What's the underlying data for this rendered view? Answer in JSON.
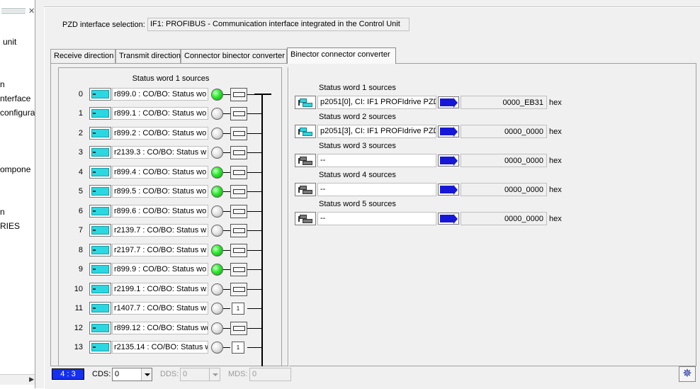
{
  "tree": {
    "lines": [
      "unit",
      "n",
      "nterface",
      "configura",
      "ompone",
      "n",
      "RIES"
    ]
  },
  "pzd": {
    "label": "PZD interface selection:",
    "value": "IF1:  PROFIBUS - Communication interface integrated in the Control Unit"
  },
  "tabs": [
    {
      "label": "Receive direction"
    },
    {
      "label": "Transmit direction"
    },
    {
      "label": "Connector binector converter"
    },
    {
      "label": "Binector connector converter"
    }
  ],
  "left_group": {
    "title": "Status word 1 sources",
    "rows": [
      {
        "num": "0",
        "source": "r899.0 : CO/BO: Status wo",
        "state": "on",
        "box": "inv"
      },
      {
        "num": "1",
        "source": "r899.1 : CO/BO: Status wo",
        "state": "off",
        "box": "inv"
      },
      {
        "num": "2",
        "source": "r899.2 : CO/BO: Status wo",
        "state": "off",
        "box": "inv"
      },
      {
        "num": "3",
        "source": "r2139.3 : CO/BO: Status w",
        "state": "off",
        "box": "inv"
      },
      {
        "num": "4",
        "source": "r899.4 : CO/BO: Status wo",
        "state": "on",
        "box": "inv"
      },
      {
        "num": "5",
        "source": "r899.5 : CO/BO: Status wo",
        "state": "on",
        "box": "inv"
      },
      {
        "num": "6",
        "source": "r899.6 : CO/BO: Status wo",
        "state": "off",
        "box": "inv"
      },
      {
        "num": "7",
        "source": "r2139.7 : CO/BO: Status w",
        "state": "off",
        "box": "inv"
      },
      {
        "num": "8",
        "source": "r2197.7 : CO/BO: Status w",
        "state": "on",
        "box": "inv"
      },
      {
        "num": "9",
        "source": "r899.9 : CO/BO: Status wo",
        "state": "on",
        "box": "inv"
      },
      {
        "num": "10",
        "source": "r2199.1 : CO/BO: Status w",
        "state": "off",
        "box": "inv"
      },
      {
        "num": "11",
        "source": "r1407.7 : CO/BO: Status w",
        "state": "off",
        "box": "one"
      },
      {
        "num": "12",
        "source": "r899.12 : CO/BO: Status wo",
        "state": "off",
        "box": "inv"
      },
      {
        "num": "13",
        "source": "r2135.14 : CO/BO: Status w",
        "state": "off",
        "box": "one"
      }
    ],
    "one_label": "1"
  },
  "right_group": [
    {
      "title": "Status word 1 sources",
      "source": "p2051[0], CI: IF1 PROFIdrive PZD",
      "hex": "0000_EB31",
      "unit": "hex",
      "icon": "cyan"
    },
    {
      "title": "Status word 2 sources",
      "source": "p2051[3], CI: IF1 PROFIdrive PZD",
      "hex": "0000_0000",
      "unit": "hex",
      "icon": "cyan"
    },
    {
      "title": "Status word 3 sources",
      "source": "--",
      "hex": "0000_0000",
      "unit": "hex",
      "icon": "gray"
    },
    {
      "title": "Status word 4 sources",
      "source": "--",
      "hex": "0000_0000",
      "unit": "hex",
      "icon": "gray"
    },
    {
      "title": "Status word 5 sources",
      "source": "--",
      "hex": "0000_0000",
      "unit": "hex",
      "icon": "gray"
    }
  ],
  "statusbar": {
    "indicator": "4 : 3",
    "cds_label": "CDS:",
    "cds_value": "0",
    "dds_label": "DDS:",
    "dds_value": "0",
    "mds_label": "MDS:",
    "mds_value": "0"
  }
}
